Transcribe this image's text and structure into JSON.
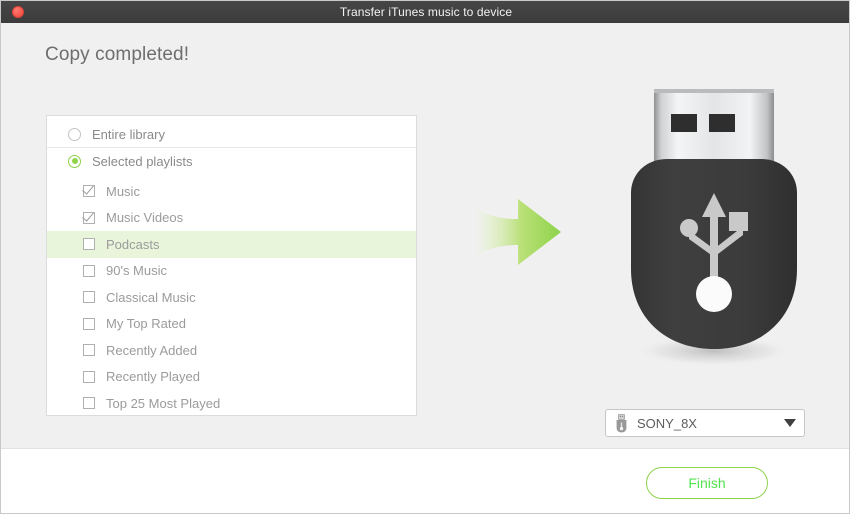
{
  "window": {
    "title": "Transfer iTunes music to device",
    "close_icon": "close-circle-icon"
  },
  "main": {
    "heading": "Copy completed!",
    "source_options": {
      "name": "library-source",
      "items": [
        {
          "label": "Entire library",
          "selected": false
        },
        {
          "label": "Selected playlists",
          "selected": true
        }
      ]
    },
    "playlists": [
      {
        "label": "Music",
        "checked": true,
        "highlighted": false
      },
      {
        "label": "Music Videos",
        "checked": true,
        "highlighted": false
      },
      {
        "label": "Podcasts",
        "checked": false,
        "highlighted": true
      },
      {
        "label": "90's Music",
        "checked": false,
        "highlighted": false
      },
      {
        "label": "Classical Music",
        "checked": false,
        "highlighted": false
      },
      {
        "label": "My Top Rated",
        "checked": false,
        "highlighted": false
      },
      {
        "label": "Recently Added",
        "checked": false,
        "highlighted": false
      },
      {
        "label": "Recently Played",
        "checked": false,
        "highlighted": false
      },
      {
        "label": "Top 25 Most Played",
        "checked": false,
        "highlighted": false
      }
    ],
    "transfer_arrow_icon": "right-arrow-icon",
    "usb_drive_icon": "usb-flash-drive-icon",
    "device": {
      "icon": "usb-drive-small-icon",
      "selected": "SONY_8X",
      "caret_icon": "chevron-down-icon"
    }
  },
  "footer": {
    "finish_label": "Finish"
  },
  "colors": {
    "accent_green": "#8ed34a",
    "finish_text_green": "#53e34e",
    "highlight_row": "#e9f5db",
    "titlebar": "#3f3f3f",
    "body_background": "#f0f0f0",
    "drive_body": "#3c3c3c",
    "close_button_red": "#fa5b50"
  }
}
